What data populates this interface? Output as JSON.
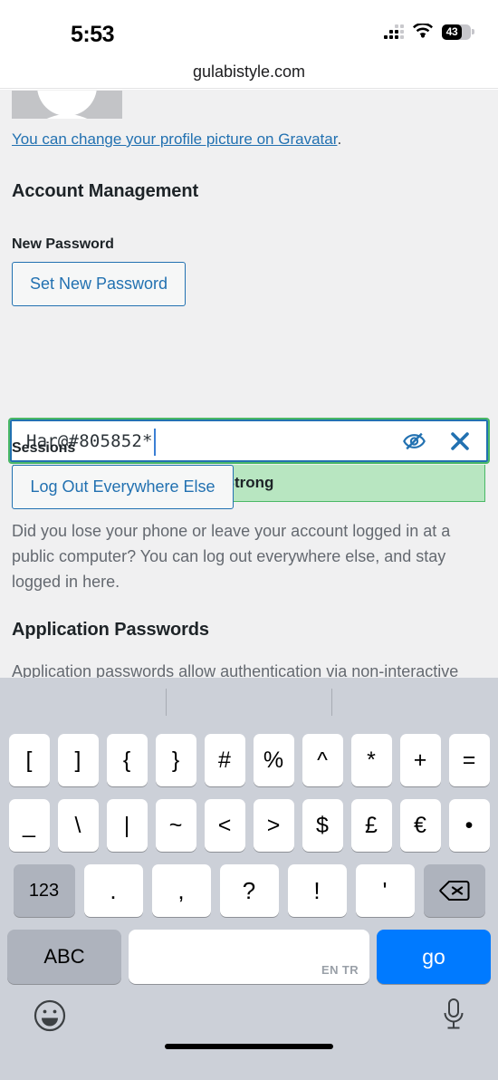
{
  "status_bar": {
    "time": "5:53",
    "battery_percent": "43",
    "icons": [
      "cellular-signal-icon",
      "wifi-icon",
      "battery-icon"
    ]
  },
  "browser": {
    "url": "gulabistyle.com"
  },
  "page": {
    "avatar_alt": "default-gravatar-avatar",
    "gravatar_notice": {
      "link_text": "You can change your profile picture on Gravatar",
      "trailing": "."
    },
    "headings": {
      "account_management": "Account Management",
      "application_passwords": "Application Passwords"
    },
    "new_password": {
      "label": "New Password",
      "set_button": "Set New Password",
      "value": "Har@#805852*",
      "placeholder": "",
      "hide_icon": "eye-slash-icon",
      "clear_icon": "close-x-icon",
      "strength": "Strong",
      "strength_color": "#4ab866",
      "strength_bg": "#b8e6c1"
    },
    "sessions": {
      "label": "Sessions",
      "logout_button": "Log Out Everywhere Else",
      "description": "Did you lose your phone or leave your account logged in at a public computer? You can log out everywhere else, and stay logged in here."
    },
    "application_passwords": {
      "description": "Application passwords allow authentication via non-interactive"
    },
    "accent_color": "#2271b1",
    "background": "#f0f0f1"
  },
  "keyboard": {
    "layout": "symbols",
    "predictive_suggestions": [
      "",
      "",
      ""
    ],
    "row1": [
      "[",
      "]",
      "{",
      "}",
      "#",
      "%",
      "^",
      "*",
      "+",
      "="
    ],
    "row2": [
      "_",
      "\\",
      "|",
      "~",
      "<",
      ">",
      "$",
      "£",
      "€",
      "•"
    ],
    "row3": {
      "numeric_toggle": "123",
      "punctuation": [
        ".",
        ",",
        "?",
        "!",
        "'"
      ],
      "delete_icon": "backspace-delete-icon"
    },
    "row4": {
      "alpha_toggle": "ABC",
      "space_label": "",
      "space_language_hint": "EN TR",
      "return_key": "go",
      "return_key_color": "#007aff"
    },
    "bottom": {
      "emoji_icon": "emoji-smiley-icon",
      "dictation_icon": "microphone-icon"
    },
    "background": "#ccd0d8"
  }
}
